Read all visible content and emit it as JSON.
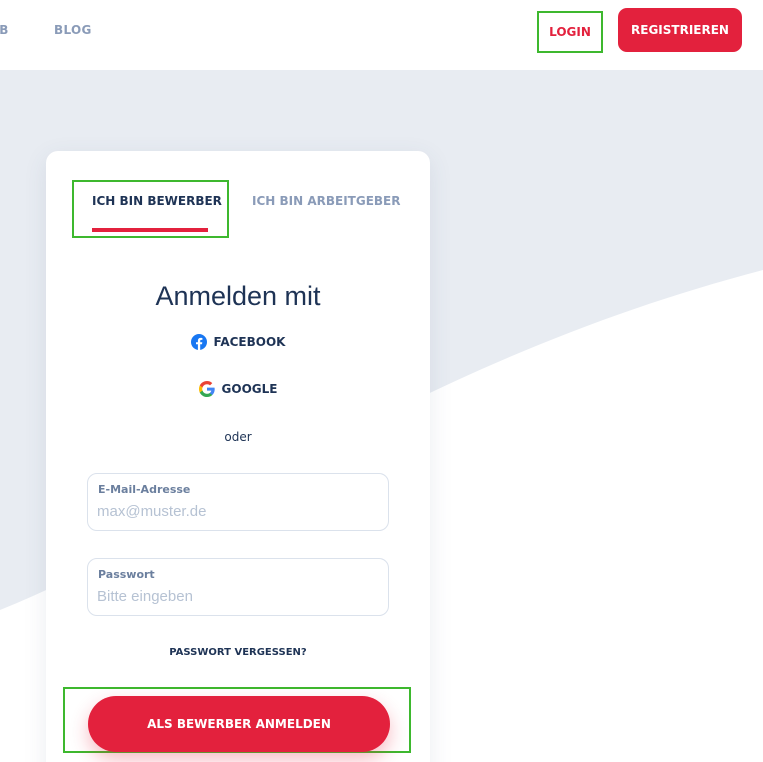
{
  "header": {
    "nav": [
      {
        "label": "JOB"
      },
      {
        "label": "BLOG"
      }
    ],
    "login_label": "LOGIN",
    "register_label": "REGISTRIEREN"
  },
  "card": {
    "tabs": [
      {
        "label": "ICH BIN BEWERBER",
        "active": true
      },
      {
        "label": "ICH BIN ARBEITGEBER",
        "active": false
      }
    ],
    "title": "Anmelden mit",
    "social": [
      {
        "label": "FACEBOOK",
        "icon": "facebook-icon"
      },
      {
        "label": "GOOGLE",
        "icon": "google-icon"
      }
    ],
    "separator": "oder",
    "email": {
      "label": "E-Mail-Adresse",
      "placeholder": "max@muster.de",
      "value": ""
    },
    "password": {
      "label": "Passwort",
      "placeholder": "Bitte eingeben",
      "value": ""
    },
    "forgot_label": "PASSWORT VERGESSEN?",
    "submit_label": "ALS BEWERBER ANMELDEN"
  },
  "colors": {
    "accent": "#e3213d",
    "text_dark": "#1e3355",
    "text_muted": "#8a9bb8",
    "background": "#e8ecf2",
    "highlight_outline": "#3db82e"
  }
}
